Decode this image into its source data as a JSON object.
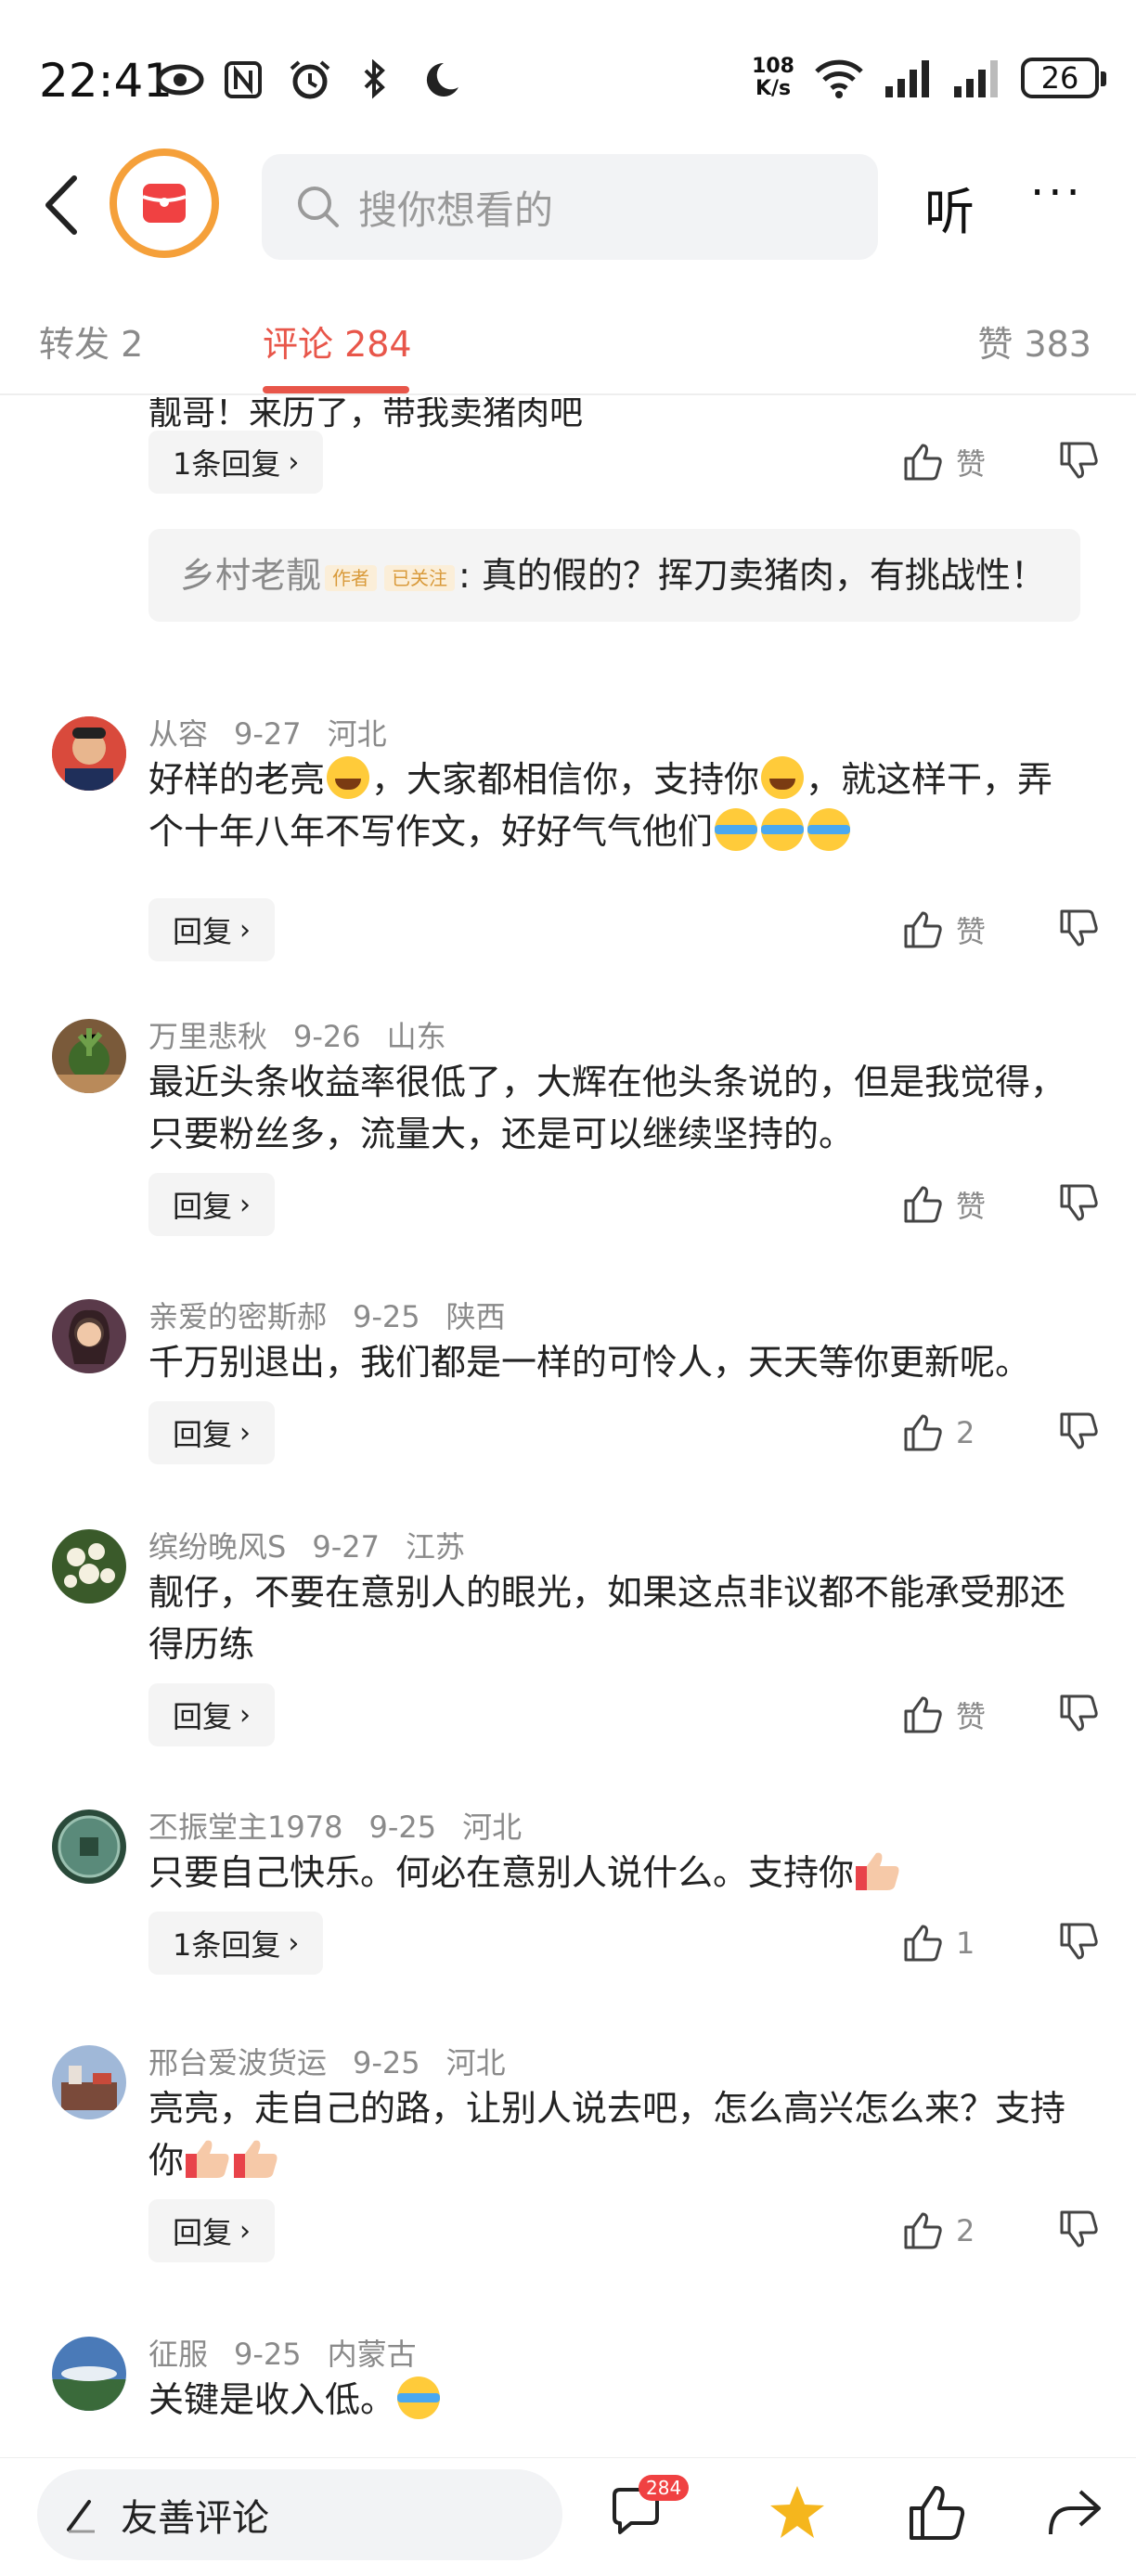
{
  "status_bar": {
    "time": "22:41",
    "net_speed_value": "108",
    "net_speed_unit": "K/s",
    "battery": "26"
  },
  "header": {
    "search_placeholder": "搜你想看的",
    "listen_label": "听",
    "more_label": "···",
    "logo_icon": "toutiao-logo-icon"
  },
  "tabs": [
    {
      "label": "转发 2"
    },
    {
      "label": "评论 284",
      "active": true
    },
    {
      "label": "赞 383"
    }
  ],
  "thread_top": {
    "cut_text": "靓哥！来历了，带我卖猪肉吧",
    "replies_label": "1条回复",
    "like_label": "赞",
    "quote_author": "乡村老靓",
    "quote_tag_author": "作者",
    "quote_tag_followed": "已关注",
    "quote_text": ": 真的假的？挥刀卖猪肉，有挑战性！"
  },
  "comments": [
    {
      "user": "从容",
      "date": "9-27",
      "region": "河北",
      "text_parts": [
        "好样的老亮",
        "，大家都相信你，支持你",
        "，就这样干，弄个十年八年不写作文，好好气气他们"
      ],
      "reply_label": "回复",
      "like_label": "赞"
    },
    {
      "user": "万里悲秋",
      "date": "9-26",
      "region": "山东",
      "text": "最近头条收益率很低了，大辉在他头条说的，但是我觉得，只要粉丝多，流量大，还是可以继续坚持的。",
      "reply_label": "回复",
      "like_label": "赞"
    },
    {
      "user": "亲爱的密斯郝",
      "date": "9-25",
      "region": "陕西",
      "text": "千万别退出，我们都是一样的可怜人，天天等你更新呢。",
      "reply_label": "回复",
      "like_label": "2"
    },
    {
      "user": "缤纷晚风S",
      "date": "9-27",
      "region": "江苏",
      "text": "靓仔，不要在意别人的眼光，如果这点非议都不能承受那还得历练",
      "reply_label": "回复",
      "like_label": "赞"
    },
    {
      "user": "丕振堂主1978",
      "date": "9-25",
      "region": "河北",
      "text": "只要自己快乐。何必在意别人说什么。支持你",
      "reply_label": "1条回复",
      "like_label": "1"
    },
    {
      "user": "邢台爱波货运",
      "date": "9-25",
      "region": "河北",
      "text": "亮亮，走自己的路，让别人说去吧，怎么高兴怎么来？支持你",
      "reply_label": "回复",
      "like_label": "2"
    },
    {
      "user": "征服",
      "date": "9-25",
      "region": "内蒙古",
      "text": "关键是收入低。"
    }
  ],
  "bottom_bar": {
    "input_label": "友善评论",
    "comment_badge": "284"
  },
  "colors": {
    "accent": "#e8564a",
    "star": "#f5b61d",
    "badge": "#f04142",
    "logo_ring": "#f5a03a"
  }
}
